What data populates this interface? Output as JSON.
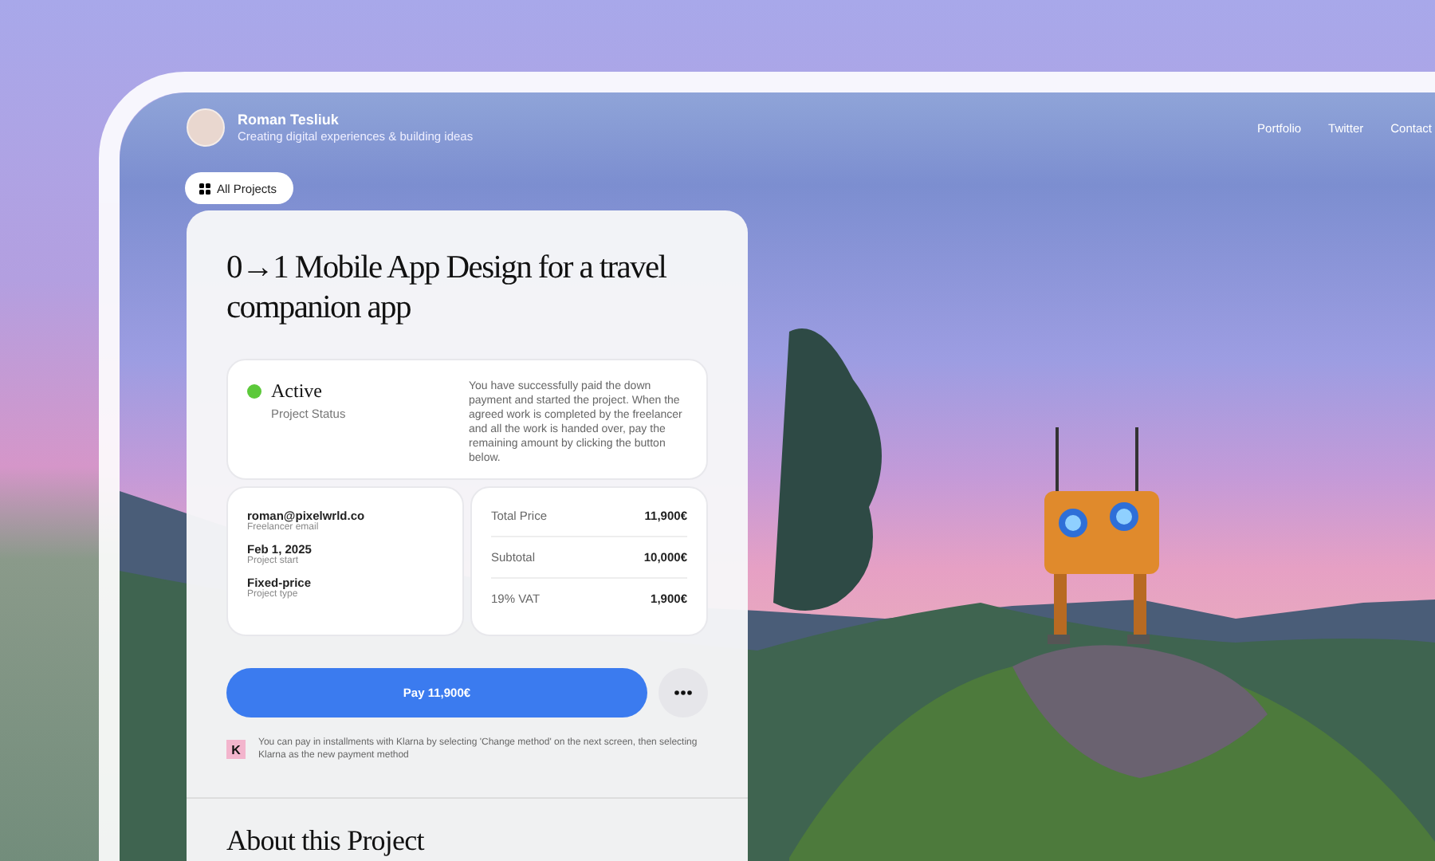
{
  "profile": {
    "name": "Roman Tesliuk",
    "tagline": "Creating digital experiences & building ideas"
  },
  "nav": [
    {
      "label": "Portfolio"
    },
    {
      "label": "Twitter"
    },
    {
      "label": "Contact"
    }
  ],
  "back_button": {
    "label": "All Projects"
  },
  "project": {
    "title": "0→1 Mobile App Design for a travel companion app",
    "status": {
      "label": "Active",
      "caption": "Project Status"
    },
    "status_message": "You have successfully paid the down payment and started the project. When the agreed work is completed by the freelancer and all the work is handed over, pay the remaining amount by clicking the button below.",
    "details": [
      {
        "value": "roman@pixelwrld.co",
        "caption": "Freelancer email"
      },
      {
        "value": "Feb 1, 2025",
        "caption": "Project start"
      },
      {
        "value": "Fixed-price",
        "caption": "Project type"
      }
    ],
    "pricing": [
      {
        "label": "Total Price",
        "amount": "11,900€"
      },
      {
        "label": "Subtotal",
        "amount": "10,000€"
      },
      {
        "label": "19% VAT",
        "amount": "1,900€"
      }
    ],
    "pay_button": {
      "label": "Pay 11,900€"
    },
    "klarna": {
      "badge": "K",
      "note": "You can pay in installments with Klarna by selecting  'Change method' on the next screen, then selecting Klarna as the new payment method"
    },
    "about_heading": "About this Project"
  }
}
